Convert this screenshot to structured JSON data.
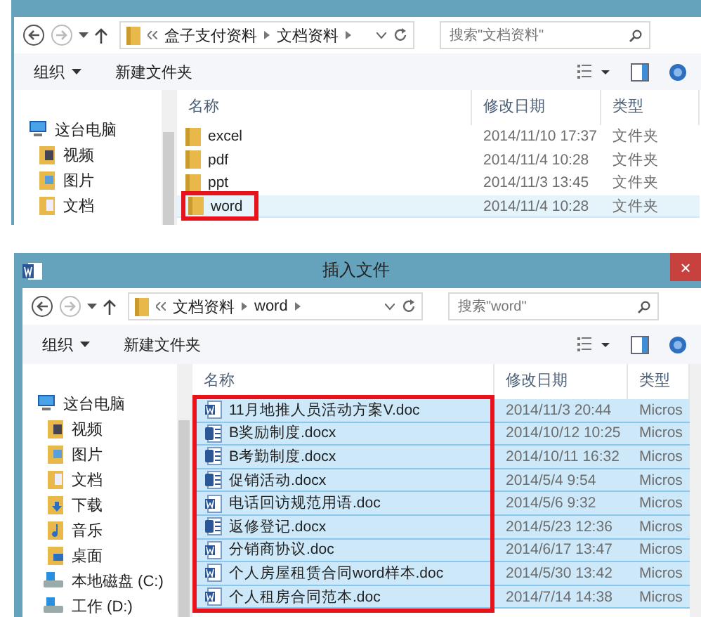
{
  "dialogs": [
    {
      "address": {
        "crumbs": [
          "盒子支付资料",
          "文档资料"
        ]
      },
      "search": {
        "placeholder": "搜索\"文档资料\""
      },
      "toolbar": {
        "organize": "组织",
        "new_folder": "新建文件夹"
      },
      "sidebar": {
        "items": [
          {
            "label": "这台电脑",
            "kind": "pc"
          },
          {
            "label": "视频",
            "kind": "videos"
          },
          {
            "label": "图片",
            "kind": "pictures"
          },
          {
            "label": "文档",
            "kind": "documents"
          }
        ]
      },
      "columns": [
        "名称",
        "修改日期",
        "类型"
      ],
      "files": [
        {
          "name": "excel",
          "kind": "folder",
          "modified": "2014/11/10 17:37",
          "type": "文件夹",
          "selected": false
        },
        {
          "name": "pdf",
          "kind": "folder",
          "modified": "2014/11/4 10:28",
          "type": "文件夹",
          "selected": false
        },
        {
          "name": "ppt",
          "kind": "folder",
          "modified": "2014/11/3 13:45",
          "type": "文件夹",
          "selected": false
        },
        {
          "name": "word",
          "kind": "folder",
          "modified": "2014/11/4 10:28",
          "type": "文件夹",
          "selected": true
        }
      ]
    },
    {
      "title": "插入文件",
      "close": "×",
      "address": {
        "crumbs": [
          "文档资料",
          "word"
        ]
      },
      "search": {
        "placeholder": "搜索\"word\""
      },
      "toolbar": {
        "organize": "组织",
        "new_folder": "新建文件夹"
      },
      "sidebar": {
        "items": [
          {
            "label": "这台电脑",
            "kind": "pc"
          },
          {
            "label": "视频",
            "kind": "videos"
          },
          {
            "label": "图片",
            "kind": "pictures"
          },
          {
            "label": "文档",
            "kind": "documents"
          },
          {
            "label": "下载",
            "kind": "downloads"
          },
          {
            "label": "音乐",
            "kind": "music"
          },
          {
            "label": "桌面",
            "kind": "desktop"
          },
          {
            "label": "本地磁盘 (C:)",
            "kind": "drive"
          },
          {
            "label": "工作 (D:)",
            "kind": "drive"
          }
        ]
      },
      "columns": [
        "名称",
        "修改日期",
        "类型"
      ],
      "files": [
        {
          "name": "11月地推人员活动方案V.doc",
          "kind": "doc",
          "modified": "2014/11/3 20:44",
          "type": "Micros",
          "selected": true
        },
        {
          "name": "B奖励制度.docx",
          "kind": "docx",
          "modified": "2014/10/12 10:25",
          "type": "Micros",
          "selected": true
        },
        {
          "name": "B考勤制度.docx",
          "kind": "docx",
          "modified": "2014/10/11 16:32",
          "type": "Micros",
          "selected": true
        },
        {
          "name": "促销活动.docx",
          "kind": "docx",
          "modified": "2014/5/4 9:54",
          "type": "Micros",
          "selected": true
        },
        {
          "name": "电话回访规范用语.doc",
          "kind": "doc",
          "modified": "2014/5/6 9:32",
          "type": "Micros",
          "selected": true
        },
        {
          "name": "返修登记.docx",
          "kind": "docx",
          "modified": "2014/5/23 12:36",
          "type": "Micros",
          "selected": true
        },
        {
          "name": "分销商协议.doc",
          "kind": "doc",
          "modified": "2014/6/17 13:47",
          "type": "Micros",
          "selected": true
        },
        {
          "name": "个人房屋租赁合同word样本.doc",
          "kind": "doc",
          "modified": "2014/5/30 13:42",
          "type": "Micros",
          "selected": true
        },
        {
          "name": "个人租房合同范本.doc",
          "kind": "doc",
          "modified": "2014/7/14 14:38",
          "type": "Micros",
          "selected": true
        }
      ]
    }
  ]
}
